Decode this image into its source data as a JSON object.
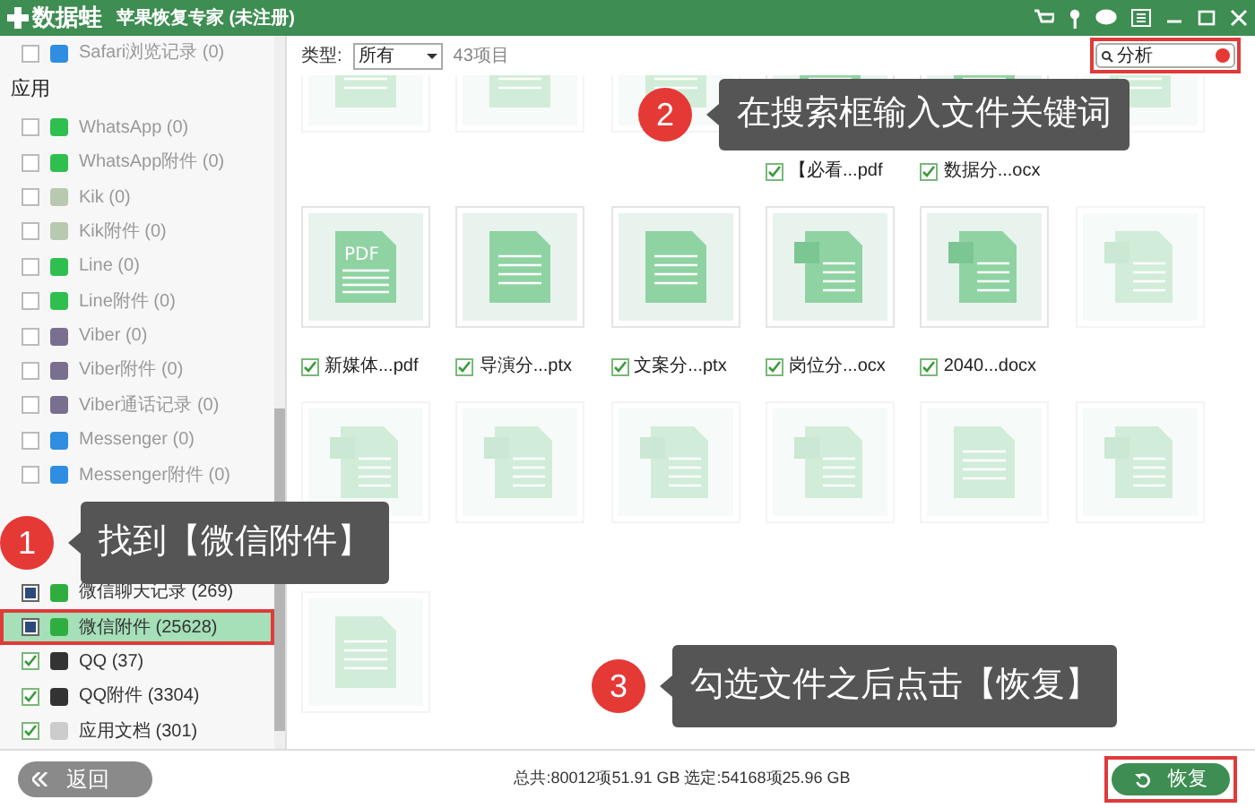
{
  "window": {
    "logo": "数据蛙",
    "title": "苹果恢复专家 (未注册)"
  },
  "sidebar": {
    "items": [
      {
        "kind": "safari",
        "label": "Safari浏览记录 (0)",
        "checked": false,
        "partial": false,
        "selected": false
      },
      {
        "kind": "heading",
        "label": "应用"
      },
      {
        "kind": "whatsapp",
        "label": "WhatsApp (0)",
        "checked": false,
        "partial": false,
        "selected": false
      },
      {
        "kind": "whatsapp",
        "label": "WhatsApp附件 (0)",
        "checked": false,
        "partial": false,
        "selected": false
      },
      {
        "kind": "kik",
        "label": "Kik (0)",
        "checked": false,
        "partial": false,
        "selected": false
      },
      {
        "kind": "kik",
        "label": "Kik附件 (0)",
        "checked": false,
        "partial": false,
        "selected": false
      },
      {
        "kind": "line",
        "label": "Line (0)",
        "checked": false,
        "partial": false,
        "selected": false
      },
      {
        "kind": "line",
        "label": "Line附件 (0)",
        "checked": false,
        "partial": false,
        "selected": false
      },
      {
        "kind": "viber",
        "label": "Viber (0)",
        "checked": false,
        "partial": false,
        "selected": false
      },
      {
        "kind": "viber",
        "label": "Viber附件 (0)",
        "checked": false,
        "partial": false,
        "selected": false
      },
      {
        "kind": "viber",
        "label": "Viber通话记录 (0)",
        "checked": false,
        "partial": false,
        "selected": false
      },
      {
        "kind": "messenger",
        "label": "Messenger (0)",
        "checked": false,
        "partial": false,
        "selected": false
      },
      {
        "kind": "messenger",
        "label": "Messenger附件 (0)",
        "checked": false,
        "partial": false,
        "selected": false
      },
      {
        "kind": "covered"
      },
      {
        "kind": "wechat",
        "label": "微信聊天记录 (269)",
        "checked": false,
        "partial": true,
        "selected": false
      },
      {
        "kind": "wechat",
        "label": "微信附件 (25628)",
        "checked": false,
        "partial": true,
        "selected": true
      },
      {
        "kind": "qq",
        "label": "QQ (37)",
        "checked": true,
        "partial": false,
        "selected": false
      },
      {
        "kind": "qq",
        "label": "QQ附件 (3304)",
        "checked": true,
        "partial": false,
        "selected": false
      },
      {
        "kind": "doc",
        "label": "应用文档 (301)",
        "checked": true,
        "partial": false,
        "selected": false
      }
    ]
  },
  "toolbar": {
    "type_label": "类型:",
    "type_value": "所有",
    "count": "43项目",
    "search": {
      "value": "分析"
    }
  },
  "files": [
    {
      "kind": "doc",
      "faded": true
    },
    {
      "kind": "doc",
      "faded": true
    },
    {
      "kind": "doc",
      "faded": true
    },
    {
      "kind": "doc",
      "faded": false,
      "name": "【必看...pdf",
      "checked": true
    },
    {
      "kind": "doc",
      "faded": false,
      "name": "数据分...ocx",
      "checked": true
    },
    {
      "kind": "doc",
      "faded": true
    },
    {
      "kind": "pdf",
      "faded": false,
      "badge": "PDF",
      "name": "新媒体...pdf",
      "checked": true
    },
    {
      "kind": "doc",
      "faded": false,
      "name": "导演分...ptx",
      "checked": true
    },
    {
      "kind": "doc",
      "faded": false,
      "name": "文案分...ptx",
      "checked": true
    },
    {
      "kind": "word",
      "faded": false,
      "name": "岗位分...ocx",
      "checked": true
    },
    {
      "kind": "word",
      "faded": false,
      "name": "2040...docx",
      "checked": true
    },
    {
      "kind": "word",
      "faded": true
    },
    {
      "kind": "word",
      "faded": true
    },
    {
      "kind": "word",
      "faded": true
    },
    {
      "kind": "word",
      "faded": true
    },
    {
      "kind": "word",
      "faded": true
    },
    {
      "kind": "doc",
      "faded": true
    },
    {
      "kind": "word",
      "faded": true
    },
    {
      "kind": "doc",
      "faded": true
    }
  ],
  "footer": {
    "back": "返回",
    "totals": "总共:80012项51.91 GB 选定:54168项25.96 GB",
    "recover": "恢复"
  },
  "callouts": [
    {
      "number": "1",
      "text": "找到【微信附件】"
    },
    {
      "number": "2",
      "text": "在搜索框输入文件关键词"
    },
    {
      "number": "3",
      "text": "勾选文件之后点击【恢复】"
    }
  ]
}
